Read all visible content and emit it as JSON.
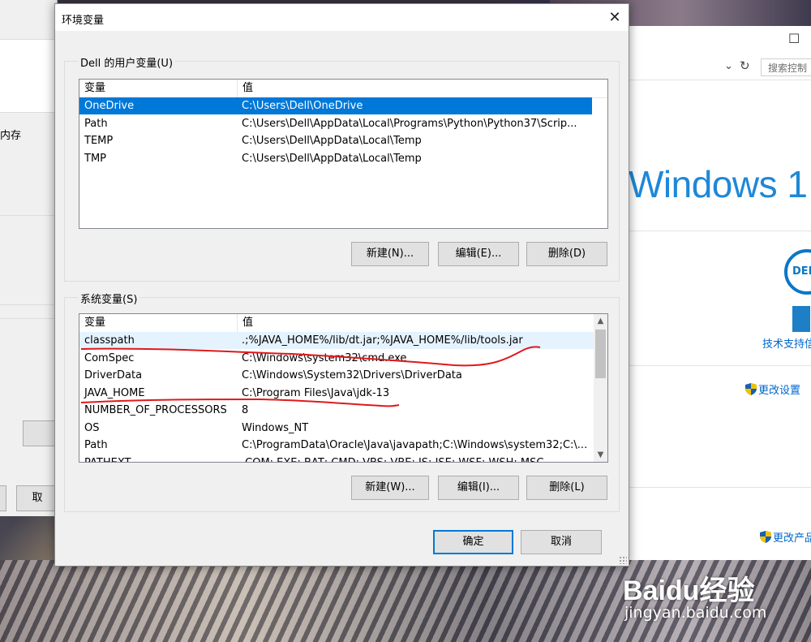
{
  "dialog": {
    "title": "环境变量",
    "close_label": "✕",
    "user_group_label": "Dell 的用户变量(U)",
    "system_group_label": "系统变量(S)",
    "col_variable": "变量",
    "col_value": "值",
    "user_vars": [
      {
        "name": "OneDrive",
        "value": "C:\\Users\\Dell\\OneDrive"
      },
      {
        "name": "Path",
        "value": "C:\\Users\\Dell\\AppData\\Local\\Programs\\Python\\Python37\\Scrip..."
      },
      {
        "name": "TEMP",
        "value": "C:\\Users\\Dell\\AppData\\Local\\Temp"
      },
      {
        "name": "TMP",
        "value": "C:\\Users\\Dell\\AppData\\Local\\Temp"
      }
    ],
    "system_vars": [
      {
        "name": "classpath",
        "value": ".;%JAVA_HOME%/lib/dt.jar;%JAVA_HOME%/lib/tools.jar"
      },
      {
        "name": "ComSpec",
        "value": "C:\\Windows\\system32\\cmd.exe"
      },
      {
        "name": "DriverData",
        "value": "C:\\Windows\\System32\\Drivers\\DriverData"
      },
      {
        "name": "JAVA_HOME",
        "value": "C:\\Program Files\\Java\\jdk-13"
      },
      {
        "name": "NUMBER_OF_PROCESSORS",
        "value": "8"
      },
      {
        "name": "OS",
        "value": "Windows_NT"
      },
      {
        "name": "Path",
        "value": "C:\\ProgramData\\Oracle\\Java\\javapath;C:\\Windows\\system32;C:\\..."
      },
      {
        "name": "PATHEXT",
        "value": ".COM;.EXE;.BAT;.CMD;.VBS;.VBE;.JS;.JSE;.WSF;.WSH;.MSC"
      }
    ],
    "user_buttons": {
      "new": "新建(N)...",
      "edit": "编辑(E)...",
      "delete": "删除(D)"
    },
    "system_buttons": {
      "new": "新建(W)...",
      "edit": "编辑(I)...",
      "delete": "删除(L)"
    },
    "ok_label": "确定",
    "cancel_label": "取消"
  },
  "left_window": {
    "text_memory": "内存",
    "button_partial": "取"
  },
  "right_window": {
    "maximize_glyph": "☐",
    "search_placeholder": "搜索控制",
    "windows_text": "Windows 1",
    "dell_logo": "DELL",
    "support_link": "技术支持信",
    "change_settings": "更改设置",
    "change_product": "更改产品"
  },
  "watermark": {
    "brand": "Baidu经验",
    "url": "jingyan.baidu.com"
  },
  "colors": {
    "selection": "#0078d7",
    "annotation": "#e0191b",
    "link": "#0066cc"
  }
}
